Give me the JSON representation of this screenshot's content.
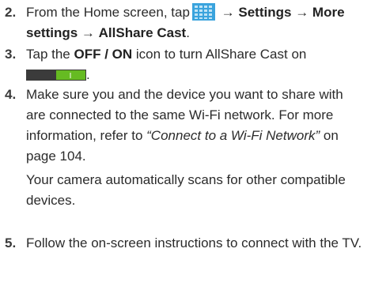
{
  "steps": [
    {
      "number": "2.",
      "line1_pre": "From the Home screen, tap",
      "arrow": "→",
      "settings": "Settings",
      "more_settings_a": "More",
      "more_settings_b": "settings",
      "allshare": "AllShare Cast",
      "period": ".",
      "apps_icon": "apps-grid-icon"
    },
    {
      "number": "3.",
      "pre": "Tap the",
      "bold": "OFF / ON",
      "post": "icon to turn AllShare Cast on",
      "period": ".",
      "toggle_icon": "on-off-toggle-icon",
      "toggle_label": "I"
    },
    {
      "number": "4.",
      "text_a": "Make sure you and the device you want to share with are connected to the same Wi-Fi network. For more information, refer to",
      "link": "“Connect to a Wi-Fi Network”",
      "text_b": "on page 104.",
      "note": "Your camera automatically scans for other compatible devices."
    },
    {
      "number": "5.",
      "text": "Follow the on-screen instructions to connect with the TV."
    }
  ],
  "colors": {
    "text": "#2b2b2b",
    "icon_blue": "#3aa3dd",
    "toggle_dark": "#3b3b3b",
    "toggle_green": "#66bb22"
  }
}
